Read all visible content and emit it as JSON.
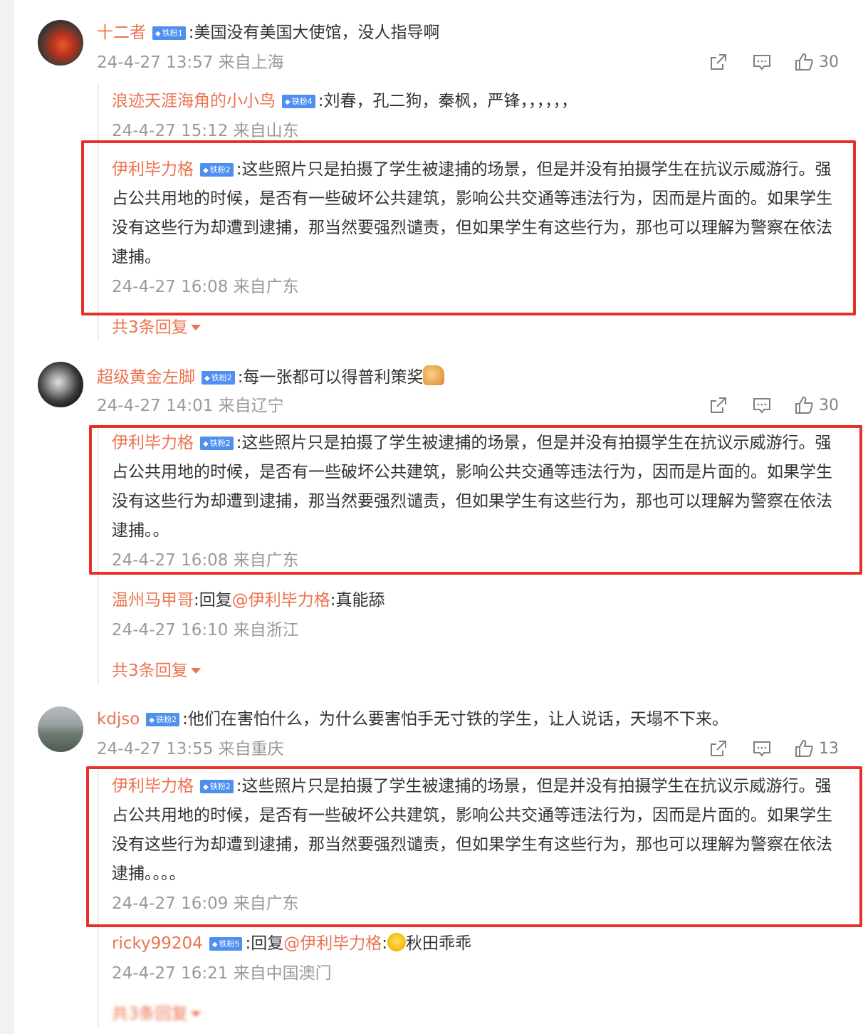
{
  "comments": [
    {
      "user": "十二者",
      "badge": "铁粉1",
      "text": ":美国没有美国大使馆，没人指导啊",
      "meta": "24-4-27 13:57 来自上海",
      "likes": "30",
      "replies": [
        {
          "user": "浪迹天涯海角的小小鸟",
          "badge": "铁粉4",
          "text": ":刘春，孔二狗，秦枫，严锋，，，，，，",
          "meta": "24-4-27 15:12 来自山东"
        },
        {
          "user": "伊利毕力格",
          "badge": "铁粉2",
          "text": ":这些照片只是拍摄了学生被逮捕的场景，但是并没有拍摄学生在抗议示威游行。强占公共用地的时候，是否有一些破坏公共建筑，影响公共交通等违法行为，因而是片面的。如果学生没有这些行为却遭到逮捕，那当然要强烈谴责，但如果学生有这些行为，那也可以理解为警察在依法逮捕。",
          "meta": "24-4-27 16:08 来自广东"
        }
      ],
      "more": "共3条回复"
    },
    {
      "user": "超级黄金左脚",
      "badge": "铁粉2",
      "text": ":每一张都可以得普利策奖",
      "meta": "24-4-27 14:01 来自辽宁",
      "likes": "30",
      "replies": [
        {
          "user": "伊利毕力格",
          "badge": "铁粉2",
          "text": ":这些照片只是拍摄了学生被逮捕的场景，但是并没有拍摄学生在抗议示威游行。强占公共用地的时候，是否有一些破坏公共建筑，影响公共交通等违法行为，因而是片面的。如果学生没有这些行为却遭到逮捕，那当然要强烈谴责，但如果学生有这些行为，那也可以理解为警察在依法逮捕。。",
          "meta": "24-4-27 16:08 来自广东"
        },
        {
          "user": "温州马甲哥",
          "pre": ":回复",
          "mention": "@伊利毕力格",
          "text": ":真能舔",
          "meta": "24-4-27 16:10 来自浙江"
        }
      ],
      "more": "共3条回复"
    },
    {
      "user": "kdjso",
      "badge": "铁粉2",
      "text": ":他们在害怕什么，为什么要害怕手无寸铁的学生，让人说话，天塌不下来。",
      "meta": "24-4-27 13:55 来自重庆",
      "likes": "13",
      "replies": [
        {
          "user": "伊利毕力格",
          "badge": "铁粉2",
          "text": ":这些照片只是拍摄了学生被逮捕的场景，但是并没有拍摄学生在抗议示威游行。强占公共用地的时候，是否有一些破坏公共建筑，影响公共交通等违法行为，因而是片面的。如果学生没有这些行为却遭到逮捕，那当然要强烈谴责，但如果学生有这些行为，那也可以理解为警察在依法逮捕。。。。",
          "meta": "24-4-27 16:09 来自广东"
        },
        {
          "user": "ricky99204",
          "badge": "铁粉5",
          "pre": ":回复",
          "mention": "@伊利毕力格",
          "text": ":秋田乖乖",
          "meta": "24-4-27 16:21 来自中国澳门"
        }
      ],
      "more": "共3条回复"
    }
  ],
  "icons": {
    "share": "share-icon",
    "comment": "comment-icon",
    "like": "like-icon",
    "emoji_thumb": "thumbs-up-emoji",
    "emoji_cry": "crying-emoji"
  },
  "colors": {
    "username": "#eb7350",
    "meta": "#999999",
    "badge": "#4f8ff0",
    "highlight_box": "#e8302a"
  }
}
